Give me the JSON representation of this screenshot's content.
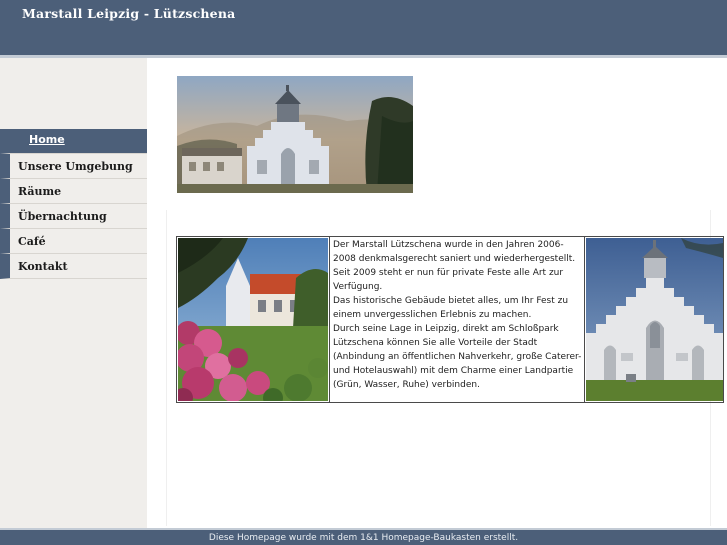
{
  "header": {
    "title": "Marstall Leipzig - Lützschena"
  },
  "nav": {
    "items": [
      {
        "label": "Home",
        "active": true
      },
      {
        "label": "Unsere Umgebung"
      },
      {
        "label": "Räume"
      },
      {
        "label": "Übernachtung"
      },
      {
        "label": "Café"
      },
      {
        "label": "Kontakt"
      }
    ]
  },
  "content": {
    "paragraphs": [
      "Der Marstall Lützschena wurde in den Jahren 2006-2008 denkmalsgerecht saniert und wiederhergestellt. Seit 2009 steht er nun für private Feste alle Art zur Verfügung.",
      "Das historische Gebäude bietet alles, um Ihr Fest zu einem unvergesslichen Erlebnis zu machen.",
      "Durch seine Lage in Leipzig, direkt am Schloßpark Lützschena können Sie alle Vorteile der Stadt (Anbindung an öffentlichen Nahverkehr, große Caterer- und Hotelauswahl) mit dem Charme einer Landpartie (Grün, Wasser, Ruhe) verbinden."
    ]
  },
  "footer": {
    "text": "Diese Homepage wurde mit dem 1&1 Homepage-Baukasten erstellt."
  },
  "colors": {
    "header": "#4c5f79",
    "sidebar": "#f0eeeb",
    "accent": "#c3cbd5"
  }
}
